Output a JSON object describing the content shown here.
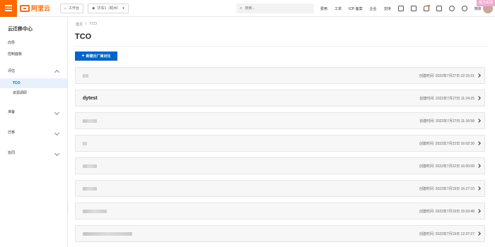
{
  "topbar": {
    "logo_text": "阿里云",
    "workbench_label": "工作台",
    "region_label": "华东1（杭州）",
    "search_placeholder": "搜索...",
    "links": [
      "费用",
      "工单",
      "ICP 备案",
      "企业",
      "支持"
    ],
    "lang_label": "简体",
    "feedback_label": "提交反馈",
    "brand_color": "#ff6a00"
  },
  "sidebar": {
    "title": "云迁移中心",
    "items": [
      "向导",
      "控制面板"
    ],
    "groups": [
      {
        "label": "评估",
        "expanded": true,
        "children": [
          {
            "label": "TCO",
            "active": true
          },
          {
            "label": "资源调研",
            "active": false
          }
        ]
      },
      {
        "label": "准备",
        "expanded": false
      },
      {
        "label": "迁移",
        "expanded": false
      },
      {
        "label": "协同",
        "expanded": false
      }
    ]
  },
  "main": {
    "breadcrumb": [
      "首页",
      "/",
      "TCO"
    ],
    "title": "TCO",
    "create_button": "新建云厂商对比",
    "accent_color": "#0064c8",
    "records": [
      {
        "name": "",
        "created": "创建时间: 2022年7月27日 22:15:31"
      },
      {
        "name": "dytest",
        "created": "创建时间: 2022年7月27日 11:24:25"
      },
      {
        "name": "",
        "created": "创建时间: 2022年7月27日 11:16:58"
      },
      {
        "name": "",
        "created": "创建时间: 2022年7月22日 16:02:30"
      },
      {
        "name": "",
        "created": "创建时间: 2022年7月22日 16:00:00"
      },
      {
        "name": "",
        "created": "创建时间: 2022年7月19日 16:27:10"
      },
      {
        "name": "",
        "created": "创建时间: 2022年7月19日 15:03:48"
      },
      {
        "name": "",
        "created": "创建时间: 2022年7月19日 12:37:27"
      }
    ]
  }
}
